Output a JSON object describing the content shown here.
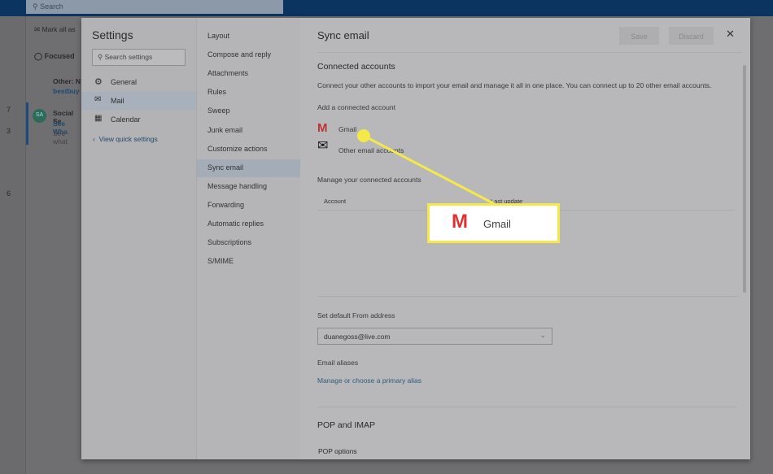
{
  "topbar": {
    "search_placeholder": "Search"
  },
  "background": {
    "mark_all": "Mark all as",
    "focused": "Focused",
    "other_line1": "Other: N",
    "other_line2": "bestbuy",
    "avatar": "SA",
    "msg_line1": "Social Se",
    "msg_line2": "See Wha",
    "msg_line3": "See what",
    "day_numbers": [
      "7",
      "3",
      "6"
    ]
  },
  "settings": {
    "title": "Settings",
    "search_placeholder": "Search settings",
    "categories": [
      {
        "label": "General",
        "icon": "gear-icon"
      },
      {
        "label": "Mail",
        "icon": "mail-icon"
      },
      {
        "label": "Calendar",
        "icon": "calendar-icon"
      }
    ],
    "quick_settings": "View quick settings"
  },
  "mail_nav": [
    "Layout",
    "Compose and reply",
    "Attachments",
    "Rules",
    "Sweep",
    "Junk email",
    "Customize actions",
    "Sync email",
    "Message handling",
    "Forwarding",
    "Automatic replies",
    "Subscriptions",
    "S/MIME"
  ],
  "content": {
    "title": "Sync email",
    "save": "Save",
    "discard": "Discard",
    "connected_heading": "Connected accounts",
    "connected_desc": "Connect your other accounts to import your email and manage it all in one place. You can connect up to 20 other email accounts.",
    "add_label": "Add a connected account",
    "gmail": "Gmail",
    "other_accounts": "Other email accounts",
    "manage_label": "Manage your connected accounts",
    "col_account": "Account",
    "col_last_update": "Last update",
    "default_from_label": "Set default From address",
    "default_from_value": "duanegoss@live.com",
    "aliases_label": "Email aliases",
    "aliases_link": "Manage or choose a primary alias",
    "pop_heading": "POP and IMAP",
    "pop_options": "POP options"
  },
  "callout": {
    "label": "Gmail",
    "color": "#f5e94a"
  }
}
